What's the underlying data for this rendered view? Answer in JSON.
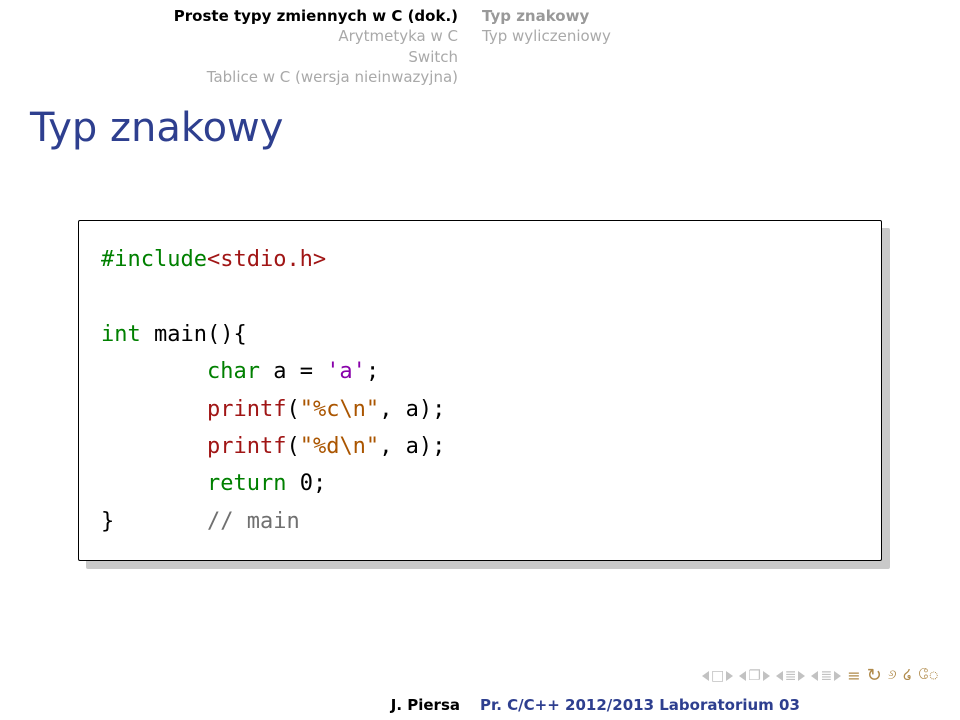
{
  "header": {
    "left": [
      {
        "text": "Proste typy zmiennych w C (dok.)",
        "cls": "bold"
      },
      {
        "text": "Arytmetyka w C",
        "cls": "light"
      },
      {
        "text": "Switch",
        "cls": "light"
      },
      {
        "text": "Tablice w C (wersja nieinwazyjna)",
        "cls": "light"
      }
    ],
    "right": [
      {
        "text": "Typ znakowy",
        "cls": "right-bold"
      },
      {
        "text": "Typ wyliczeniowy",
        "cls": "light"
      }
    ]
  },
  "title": "Typ znakowy",
  "code": {
    "l1_include": "#include",
    "l1_header": "<stdio.h>",
    "l3_int": "int",
    "l3_main": " main(){",
    "l4_indent": "        ",
    "l4_char": "char",
    "l4_rest": " a = ",
    "l4_lit": "'a'",
    "l4_semi": ";",
    "l5_printf": "printf",
    "l5_open": "(",
    "l5_str": "\"%c\\n\"",
    "l5_rest": ", a);",
    "l6_str": "\"%d\\n\"",
    "l7_return": "return",
    "l7_rest": " 0;",
    "l8_brace": "}",
    "l8_pad": "       ",
    "l8_comment": "// main"
  },
  "footer": {
    "author": "J. Piersa",
    "course": "Pr. C/C++ 2012/2013 Laboratorium 03"
  },
  "nav": {
    "box": "□",
    "doc": "❐",
    "eqlike": "≣",
    "summary_eq": "≡",
    "oqo": "୬ ໒ ே",
    "cycle": "↻"
  }
}
